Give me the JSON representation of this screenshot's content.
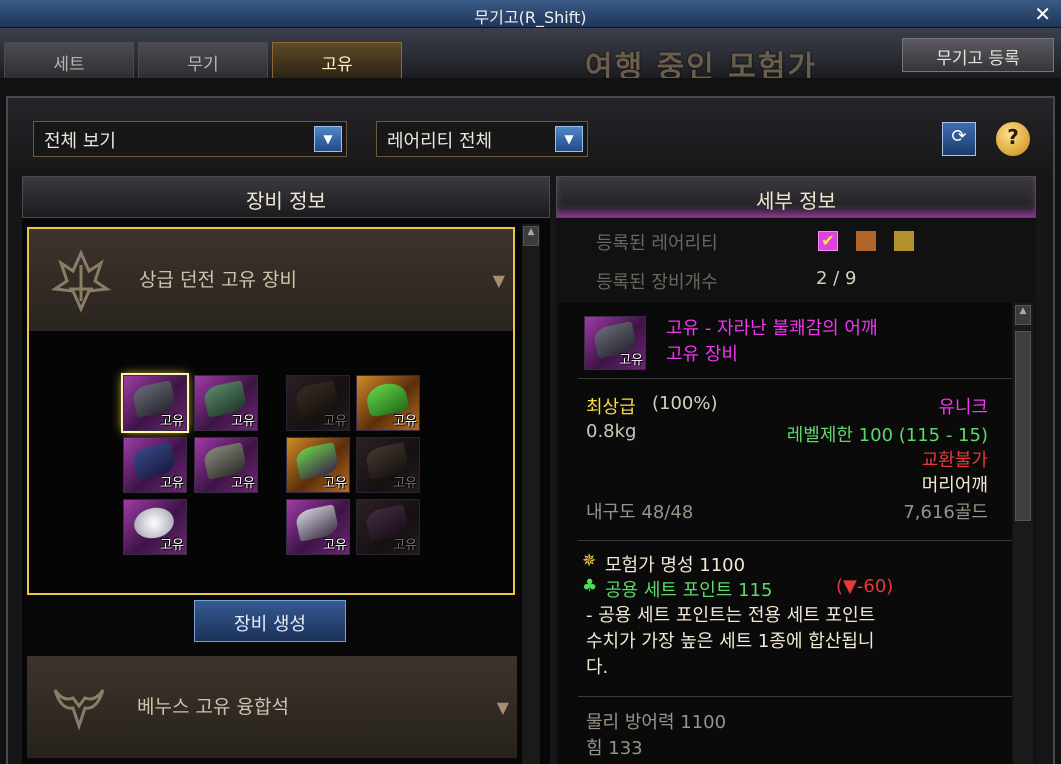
{
  "window": {
    "title": "무기고(R_Shift)",
    "close": "✕"
  },
  "tabs": [
    {
      "label": "세트"
    },
    {
      "label": "무기"
    },
    {
      "label": "고유"
    }
  ],
  "background_banner": "여행 중인 모험가",
  "register_button": "무기고 등록",
  "filters": {
    "view": "전체 보기",
    "rarity": "레어리티 전체"
  },
  "panels": {
    "equip_info": "장비 정보",
    "detail_info": "세부 정보"
  },
  "categories": [
    {
      "label": "상급 던전 고유 장비",
      "expanded": true
    },
    {
      "label": "베누스 고유 융합석",
      "expanded": false
    }
  ],
  "slot_tag": "고유",
  "generate_button": "장비 생성",
  "registered": {
    "rarity_label": "등록된 레어리티",
    "count_label": "등록된 장비개수",
    "count_value": "2 / 9",
    "rarity_colors": [
      "#e040e0",
      "#b0652a",
      "#b3902a"
    ]
  },
  "item": {
    "name": "고유 - 자라난 불쾌감의 어깨",
    "type": "고유 장비",
    "grade": "최상급",
    "grade_pct": "(100%)",
    "rarity": "유니크",
    "weight": "0.8kg",
    "level_req": "레벨제한 100 (115 - 15)",
    "trade": "교환불가",
    "slot": "머리어깨",
    "durability": "내구도 48/48",
    "price": "7,616골드",
    "fame": "모험가 명성 1100",
    "set_point": "공용 세트 포인트 115",
    "set_point_diff": "(▼-60)",
    "set_desc_1": "- 공용 세트 포인트는 전용 세트 포인트",
    "set_desc_2": "수치가 가장 높은 세트 1종에 합산됩니",
    "set_desc_3": "다.",
    "phys_def": "물리 방어력 1100",
    "str": "힘 133"
  }
}
